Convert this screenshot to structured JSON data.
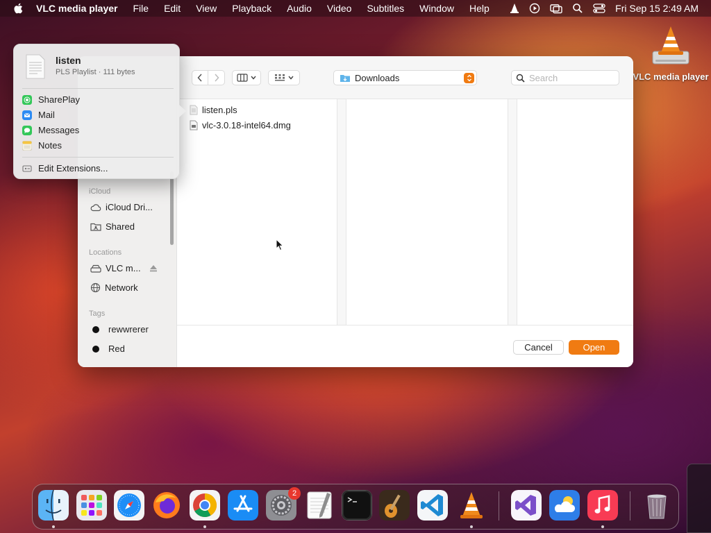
{
  "menubar": {
    "app_name": "VLC media player",
    "menus": [
      "File",
      "Edit",
      "View",
      "Playback",
      "Audio",
      "Video",
      "Subtitles",
      "Window",
      "Help"
    ],
    "clock": "Fri Sep 15  2:49 AM"
  },
  "desktop": {
    "icon_label": "VLC media player"
  },
  "dialog": {
    "location": "Downloads",
    "search_placeholder": "Search",
    "files": [
      "listen.pls",
      "vlc-3.0.18-intel64.dmg"
    ],
    "cancel_label": "Cancel",
    "open_label": "Open",
    "sidebar": {
      "icloud_title": "iCloud",
      "icloud_items": [
        "iCloud Dri...",
        "Shared"
      ],
      "locations_title": "Locations",
      "location_items": [
        "VLC m...",
        "Network"
      ],
      "tags_title": "Tags",
      "tag_items": [
        "rewwrerer",
        "Red"
      ]
    }
  },
  "share_popover": {
    "file_name": "listen",
    "file_info": "PLS Playlist · 111 bytes",
    "items": [
      "SharePlay",
      "Mail",
      "Messages",
      "Notes"
    ],
    "edit_extensions": "Edit Extensions..."
  },
  "dock": {
    "settings_badge": "2",
    "apps": [
      "finder-icon",
      "launchpad-icon",
      "safari-icon",
      "firefox-icon",
      "chrome-icon",
      "app-store-icon",
      "system-settings-icon",
      "textedit-icon",
      "terminal-icon",
      "garageband-icon",
      "vscode-icon",
      "vlc-icon",
      "visual-studio-icon",
      "weather-icon",
      "music-icon",
      "trash-icon"
    ]
  }
}
